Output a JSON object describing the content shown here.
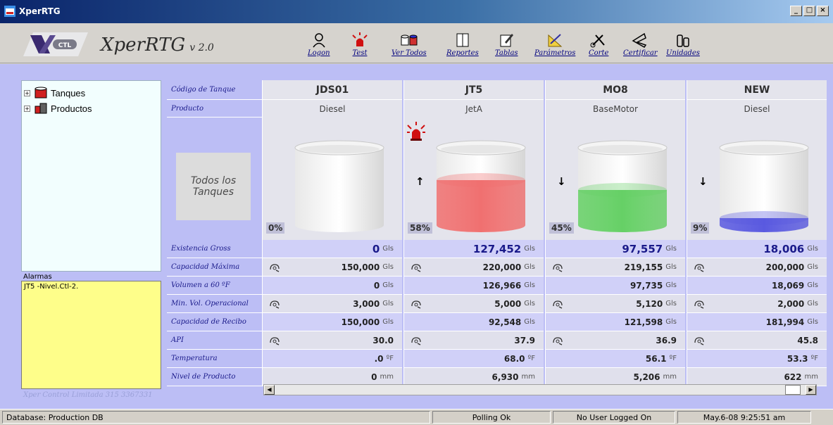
{
  "window": {
    "title": "XperRTG"
  },
  "header": {
    "app_name": "XperRTG",
    "version": "v 2.0"
  },
  "toolbar": [
    {
      "label": "Logon",
      "icon": "logon-icon"
    },
    {
      "label": "Test",
      "icon": "alarm-siren-icon"
    },
    {
      "label": "Ver Todos",
      "icon": "view-all-icon"
    },
    {
      "label": "Reportes",
      "icon": "reports-icon"
    },
    {
      "label": "Tablas",
      "icon": "tables-icon"
    },
    {
      "label": "Parámetros",
      "icon": "parameters-icon"
    },
    {
      "label": "Corte",
      "icon": "cut-icon"
    },
    {
      "label": "Certificar",
      "icon": "certify-icon"
    },
    {
      "label": "Unidades",
      "icon": "units-icon"
    }
  ],
  "tree": [
    {
      "label": "Tanques",
      "icon": "tank-icon"
    },
    {
      "label": "Productos",
      "icon": "product-icon"
    }
  ],
  "alarms": {
    "label": "Alarmas",
    "items": [
      "JT5 -Nivel.Ctl-2."
    ]
  },
  "credit": "Xper Control Limitada 315 3367331",
  "grid": {
    "row_labels": {
      "code": "Código de Tanque",
      "product": "Producto",
      "gross": "Existencia Gross",
      "max_cap": "Capacidad Máxima",
      "vol60": "Volumen a 60 ºF",
      "min_vol": "Min. Vol. Operacional",
      "recv": "Capacidad de Recibo",
      "api": "API",
      "temp": "Temperatura",
      "level": "Nivel de Producto"
    },
    "all_tanks_label": "Todos los Tanques",
    "tanks": [
      {
        "code": "JDS01",
        "product": "Diesel",
        "pct": "0%",
        "fill": 0.0,
        "liquid_color": "#ffffff",
        "trend": "",
        "gross": "0",
        "max_cap": "150,000",
        "vol60": "0",
        "min_vol": "3,000",
        "recv": "150,000",
        "api": "30.0",
        "temp": ".0",
        "level": "0",
        "alarm": false
      },
      {
        "code": "JT5",
        "product": "JetA",
        "pct": "58%",
        "fill": 0.58,
        "liquid_color": "#f07070",
        "trend": "↑",
        "gross": "127,452",
        "max_cap": "220,000",
        "vol60": "126,966",
        "min_vol": "5,000",
        "recv": "92,548",
        "api": "37.9",
        "temp": "68.0",
        "level": "6,930",
        "alarm": true
      },
      {
        "code": "MO8",
        "product": "BaseMotor",
        "pct": "45%",
        "fill": 0.45,
        "liquid_color": "#66d066",
        "trend": "↓",
        "gross": "97,557",
        "max_cap": "219,155",
        "vol60": "97,735",
        "min_vol": "5,120",
        "recv": "121,598",
        "api": "36.9",
        "temp": "56.1",
        "level": "5,206",
        "alarm": false
      },
      {
        "code": "NEW",
        "product": "Diesel",
        "pct": "9%",
        "fill": 0.09,
        "liquid_color": "#5a5ae0",
        "trend": "↓",
        "gross": "18,006",
        "max_cap": "200,000",
        "vol60": "18,069",
        "min_vol": "2,000",
        "recv": "181,994",
        "api": "45.8",
        "temp": "53.3",
        "level": "622",
        "alarm": false
      }
    ],
    "units": {
      "volume": "Gls",
      "temp": "ºF",
      "level": "mm"
    }
  },
  "statusbar": {
    "database": "Database: Production DB",
    "polling": "Polling Ok",
    "user": "No User Logged On",
    "datetime": "May.6-08  9:25:51 am"
  }
}
